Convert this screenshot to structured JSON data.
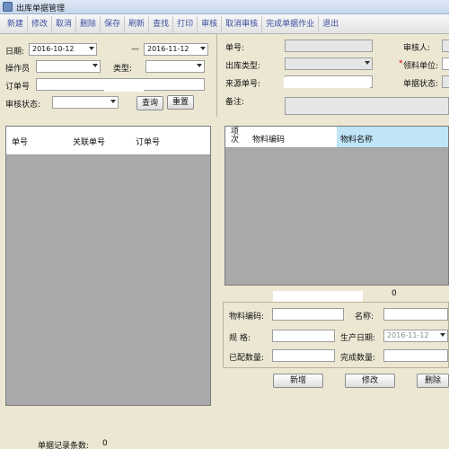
{
  "window": {
    "title": "出库单据管理"
  },
  "toolbar": [
    {
      "name": "new-button",
      "label": "新建"
    },
    {
      "name": "edit-button",
      "label": "修改"
    },
    {
      "name": "cancel-button",
      "label": "取消"
    },
    {
      "name": "delete-button",
      "label": "删除"
    },
    {
      "name": "save-button",
      "label": "保存"
    },
    {
      "name": "refresh-button",
      "label": "刷新"
    },
    {
      "name": "query-button",
      "label": "查找"
    },
    {
      "name": "print-button",
      "label": "打印"
    },
    {
      "name": "audit-button",
      "label": "审核"
    },
    {
      "name": "cancel-audit-button",
      "label": "取消审核"
    },
    {
      "name": "complete-doc-button",
      "label": "完成单据作业"
    },
    {
      "name": "exit-button",
      "label": "退出"
    }
  ],
  "filters": {
    "date_label": "日期:",
    "date_from": "2016-10-12",
    "date_sep": "—",
    "date_to": "2016-11-12",
    "operator_label": "操作员",
    "type_label": "类型:",
    "order_no_label": "订单号",
    "audit_status_label": "审核状态:",
    "query_button": "查询",
    "reset_button": "重置"
  },
  "left_grid": {
    "columns": [
      "单号",
      "关联单号",
      "订单号"
    ]
  },
  "status": {
    "count_label": "单据记录条数:",
    "count": "0"
  },
  "header_form": {
    "doc_no_label": "单号:",
    "out_type_label": "出库类型:",
    "source_no_label": "来源单号:",
    "remark_label": "备注:",
    "auditor_label": "审核人:",
    "recv_unit_label": "领料单位:",
    "doc_status_label": "单据状态:"
  },
  "right_grid": {
    "columns": [
      "项次",
      "物料编码",
      "物料名称"
    ],
    "count": "0"
  },
  "detail_form": {
    "material_code_label": "物料编码:",
    "material_name_label": "名称:",
    "spec_label": "规  格:",
    "prod_date_label": "生产日期:",
    "prod_date_value": "2016-11-12",
    "allocated_label": "已配数量:",
    "done_qty_label": "完成数量:",
    "add_button": "新增",
    "edit_button": "修改",
    "delete_button": "删除"
  },
  "colors": {
    "panel": "#ece7d3",
    "grid_bg": "#a9a9a9",
    "toolbar_text": "#3b4fa0",
    "selected_header": "#bfe5f7"
  }
}
